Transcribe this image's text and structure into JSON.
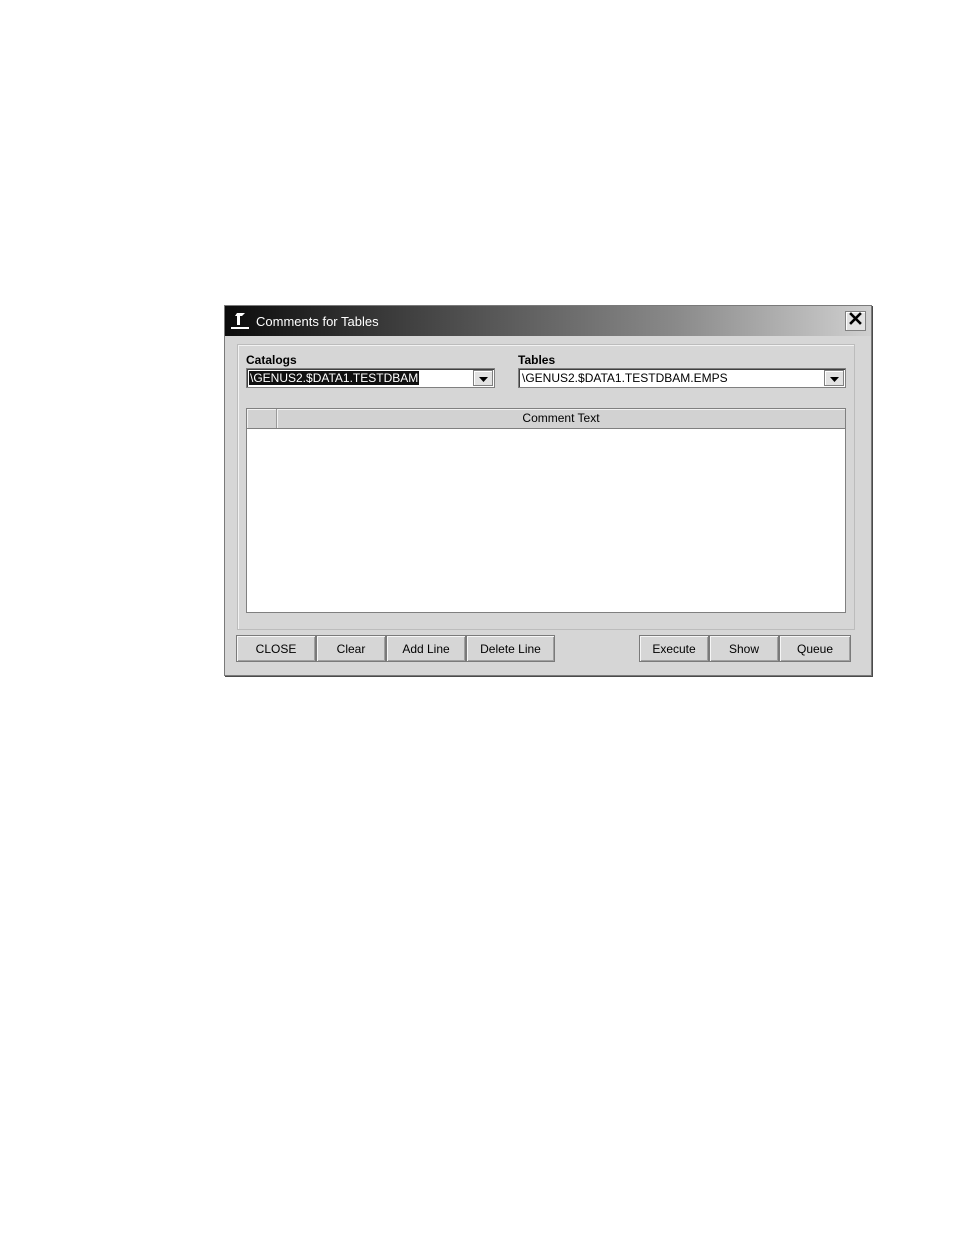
{
  "window": {
    "title": "Comments for Tables",
    "icon": "app-logo-icon",
    "close_icon": "close-icon"
  },
  "catalogs": {
    "label": "Catalogs",
    "value": "\\GENUS2.$DATA1.TESTDBAM"
  },
  "tables": {
    "label": "Tables",
    "value": "\\GENUS2.$DATA1.TESTDBAM.EMPS"
  },
  "grid": {
    "columns": [
      "Comment Text"
    ],
    "rows": []
  },
  "buttons": {
    "close": "CLOSE",
    "clear": "Clear",
    "add_line": "Add Line",
    "delete_line": "Delete Line",
    "execute": "Execute",
    "show": "Show",
    "queue": "Queue"
  }
}
